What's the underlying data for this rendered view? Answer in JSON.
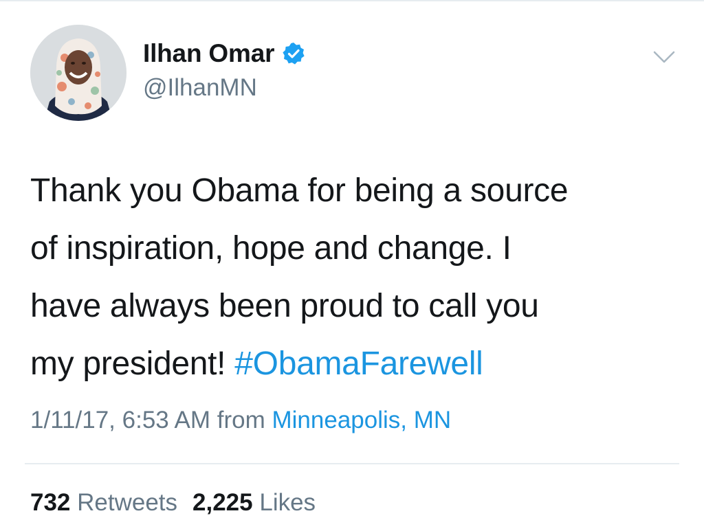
{
  "author": {
    "display_name": "Ilhan Omar",
    "handle": "@IlhanMN",
    "verified": true,
    "avatar_icon": "profile-photo"
  },
  "tweet": {
    "lines": [
      "Thank you Obama for being a source",
      "of inspiration, hope and change. I",
      "have always been proud to call you",
      "my president! "
    ],
    "hashtag": "#ObamaFarewell",
    "timestamp": "1/11/17, 6:53 AM",
    "from_label": " from ",
    "location": "Minneapolis, MN"
  },
  "stats": {
    "retweets_count": "732",
    "retweets_label": " Retweets",
    "likes_count": "2,225",
    "likes_label": " Likes"
  },
  "colors": {
    "link": "#1b95e0",
    "secondary": "#657786",
    "primary": "#14171a",
    "verified": "#1da1f2",
    "divider": "#e6ecf0"
  },
  "icons": {
    "verified": "verified-badge-icon",
    "menu": "chevron-down-icon"
  }
}
